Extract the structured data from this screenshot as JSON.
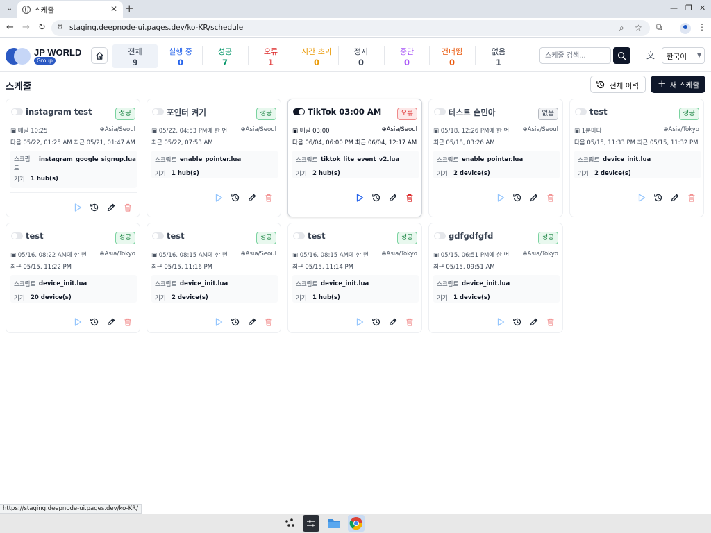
{
  "browser": {
    "tab_title": "스케줄",
    "url": "staging.deepnode-ui.pages.dev/ko-KR/schedule",
    "status_url": "https://staging.deepnode-ui.pages.dev/ko-KR/"
  },
  "brand": {
    "name": "JP WORLD",
    "badge": "Group"
  },
  "stats": [
    {
      "label": "전체",
      "value": "9",
      "color": "#374151"
    },
    {
      "label": "실행 중",
      "value": "0",
      "color": "#2563eb"
    },
    {
      "label": "성공",
      "value": "7",
      "color": "#059669"
    },
    {
      "label": "오류",
      "value": "1",
      "color": "#dc2626"
    },
    {
      "label": "시간 초과",
      "value": "0",
      "color": "#ea9a07"
    },
    {
      "label": "정지",
      "value": "0",
      "color": "#374151"
    },
    {
      "label": "중단",
      "value": "0",
      "color": "#a855f7"
    },
    {
      "label": "건너뜀",
      "value": "0",
      "color": "#ea580c"
    },
    {
      "label": "없음",
      "value": "1",
      "color": "#374151"
    }
  ],
  "search": {
    "placeholder": "스케줄 검색..."
  },
  "language": {
    "selected": "한국어"
  },
  "page": {
    "title": "스케줄",
    "history_all_label": "전체 이력",
    "new_schedule_label": "새 스케줄"
  },
  "labels": {
    "script": "스크립트",
    "device": "기기"
  },
  "cards": [
    {
      "title": "instagram test",
      "status": "성공",
      "status_type": "success",
      "enabled": false,
      "schedule": "매일 10:25",
      "timezone": "Asia/Seoul",
      "line2": "다음 05/22, 01:25 AM  최근 05/21, 01:47 AM",
      "script": "instagram_google_signup.lua",
      "device": "1 hub(s)"
    },
    {
      "title": "포인터 켜기",
      "status": "성공",
      "status_type": "success",
      "enabled": false,
      "schedule": "05/22, 04:53 PM에 한 번",
      "timezone": "Asia/Seoul",
      "line2": "최근 05/22, 07:53 AM",
      "script": "enable_pointer.lua",
      "device": "1 hub(s)"
    },
    {
      "title": "TikTok 03:00 AM",
      "status": "오류",
      "status_type": "error",
      "enabled": true,
      "schedule": "매일 03:00",
      "timezone": "Asia/Seoul",
      "line2": "다음 06/04, 06:00 PM  최근 06/04, 12:17 AM",
      "script": "tiktok_lite_event_v2.lua",
      "device": "2 hub(s)"
    },
    {
      "title": "테스트 손민아",
      "status": "없음",
      "status_type": "none",
      "enabled": false,
      "schedule": "05/18, 12:26 PM에 한 번",
      "timezone": "Asia/Seoul",
      "line2": "최근 05/18, 03:26 AM",
      "script": "enable_pointer.lua",
      "device": "2 device(s)"
    },
    {
      "title": "test",
      "status": "성공",
      "status_type": "success",
      "enabled": false,
      "schedule": "1분마다",
      "timezone": "Asia/Tokyo",
      "line2": "다음 05/15, 11:33 PM  최근 05/15, 11:32 PM",
      "script": "device_init.lua",
      "device": "2 device(s)"
    },
    {
      "title": "test",
      "status": "성공",
      "status_type": "success",
      "enabled": false,
      "schedule": "05/16, 08:22 AM에 한 번",
      "timezone": "Asia/Tokyo",
      "line2": "최근 05/15, 11:22 PM",
      "script": "device_init.lua",
      "device": "20 device(s)"
    },
    {
      "title": "test",
      "status": "성공",
      "status_type": "success",
      "enabled": false,
      "schedule": "05/16, 08:15 AM에 한 번",
      "timezone": "Asia/Seoul",
      "line2": "최근 05/15, 11:16 PM",
      "script": "device_init.lua",
      "device": "2 device(s)"
    },
    {
      "title": "test",
      "status": "성공",
      "status_type": "success",
      "enabled": false,
      "schedule": "05/16, 08:15 AM에 한 번",
      "timezone": "Asia/Tokyo",
      "line2": "최근 05/15, 11:14 PM",
      "script": "device_init.lua",
      "device": "1 hub(s)"
    },
    {
      "title": "gdfgdfgfd",
      "status": "성공",
      "status_type": "success",
      "enabled": false,
      "schedule": "05/15, 06:51 PM에 한 번",
      "timezone": "Asia/Tokyo",
      "line2": "최근 05/15, 09:51 AM",
      "script": "device_init.lua",
      "device": "1 device(s)"
    }
  ]
}
